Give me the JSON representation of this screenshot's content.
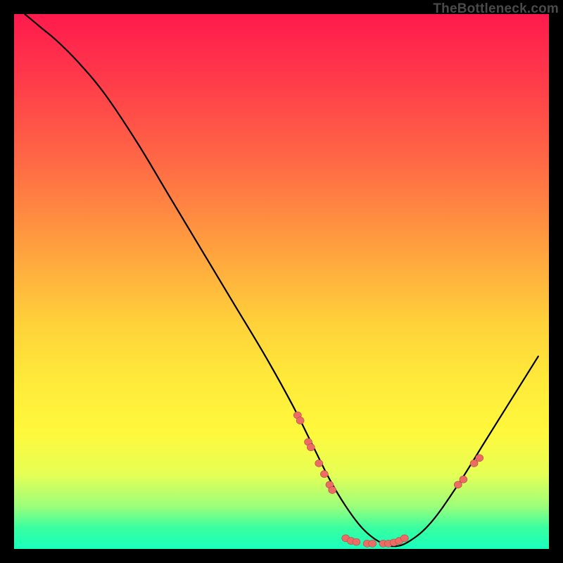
{
  "brand": "TheBottleneck.com",
  "colors": {
    "curve_stroke": "#000000",
    "dot_fill": "#ec6c65",
    "dot_stroke": "#b24d48",
    "background": "#000000"
  },
  "chart_data": {
    "type": "line",
    "title": "",
    "xlabel": "",
    "ylabel": "",
    "xlim": [
      0,
      100
    ],
    "ylim": [
      0,
      100
    ],
    "grid": false,
    "legend": false,
    "note": "No axis ticks, labels, or numeric values are shown in the image. The curve and dot positions are estimated from pixel geometry. y is inverted so that higher y means higher on the gradient (toward red).",
    "series": [
      {
        "name": "curve",
        "x": [
          2,
          5,
          8,
          12,
          17,
          23,
          29,
          35,
          41,
          47,
          52,
          56,
          59,
          62,
          65,
          68,
          71,
          74,
          78,
          83,
          88,
          93,
          98
        ],
        "y": [
          100,
          97.5,
          95,
          91,
          85,
          76,
          66,
          56,
          46,
          36,
          27,
          19,
          13,
          8,
          4,
          1.5,
          0.5,
          1.5,
          5,
          12,
          20,
          28,
          36
        ]
      }
    ],
    "dots": [
      {
        "x": 53,
        "y": 25
      },
      {
        "x": 53.5,
        "y": 24
      },
      {
        "x": 55,
        "y": 20
      },
      {
        "x": 55.5,
        "y": 19
      },
      {
        "x": 57,
        "y": 16
      },
      {
        "x": 58,
        "y": 14
      },
      {
        "x": 59,
        "y": 12
      },
      {
        "x": 59.5,
        "y": 11
      },
      {
        "x": 62,
        "y": 2
      },
      {
        "x": 63,
        "y": 1.5
      },
      {
        "x": 64,
        "y": 1.3
      },
      {
        "x": 66,
        "y": 1
      },
      {
        "x": 67,
        "y": 1
      },
      {
        "x": 69,
        "y": 1
      },
      {
        "x": 70,
        "y": 1
      },
      {
        "x": 71,
        "y": 1.2
      },
      {
        "x": 72,
        "y": 1.5
      },
      {
        "x": 73,
        "y": 2
      },
      {
        "x": 83,
        "y": 12
      },
      {
        "x": 84,
        "y": 13
      },
      {
        "x": 86,
        "y": 16
      },
      {
        "x": 87,
        "y": 17
      }
    ]
  }
}
